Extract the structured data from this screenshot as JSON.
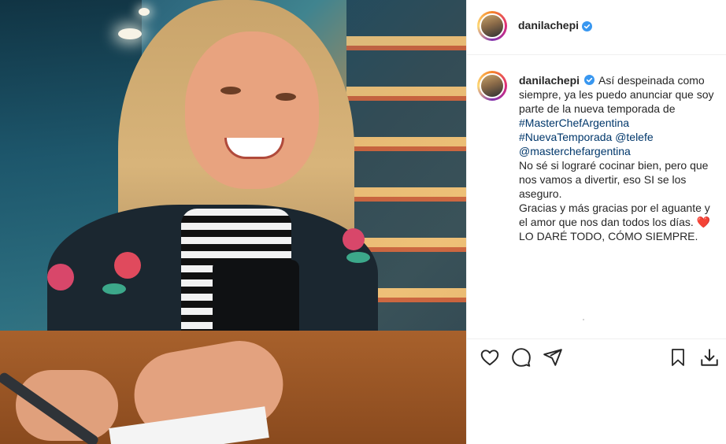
{
  "post": {
    "username": "danilachepi",
    "verified": true,
    "caption": {
      "lines": [
        "Así despeinada como",
        "siempre, ya les puedo anunciar que soy",
        "parte de la nueva temporada de"
      ],
      "hashtag1": "#MasterChefArgentina",
      "hashtag2": "#NuevaTemporada",
      "mention1": "@telefe",
      "mention2": "@masterchefargentina",
      "para2": [
        "No sé si lograré cocinar bien, pero que",
        "nos vamos a divertir, eso SI se los",
        "aseguro."
      ],
      "para3_line1": "Gracias y más gracias por el aguante y",
      "para3_line2": "el amor que nos dan todos los días.",
      "heart_emoji": "❤️",
      "para4": "LO DARÉ TODO, CÓMO SIEMPRE."
    }
  },
  "actions": {
    "like": "heart-icon",
    "comment": "comment-icon",
    "share": "share-icon",
    "save": "bookmark-icon",
    "download": "download-icon"
  },
  "colors": {
    "link": "#00376b",
    "text": "#262626",
    "verified": "#3897f0"
  }
}
